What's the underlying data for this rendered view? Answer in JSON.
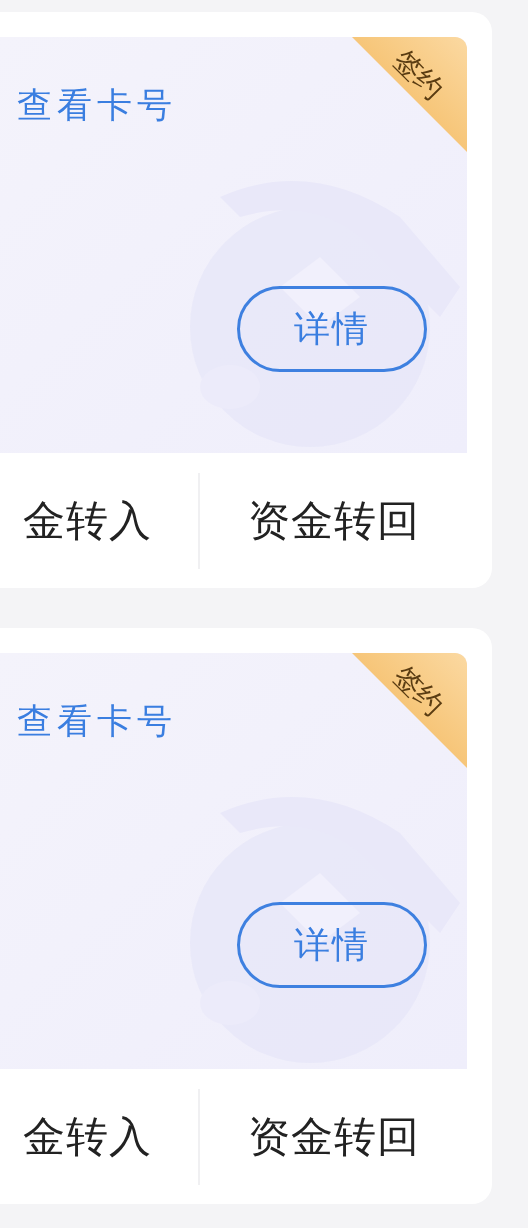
{
  "cards": [
    {
      "view_card_link": "查看卡号",
      "ribbon": "签约",
      "details_button": "详情",
      "actions": [
        "金转入",
        "资金转回"
      ]
    },
    {
      "view_card_link": "查看卡号",
      "ribbon": "签约",
      "details_button": "详情",
      "actions": [
        "金转入",
        "资金转回"
      ]
    }
  ]
}
